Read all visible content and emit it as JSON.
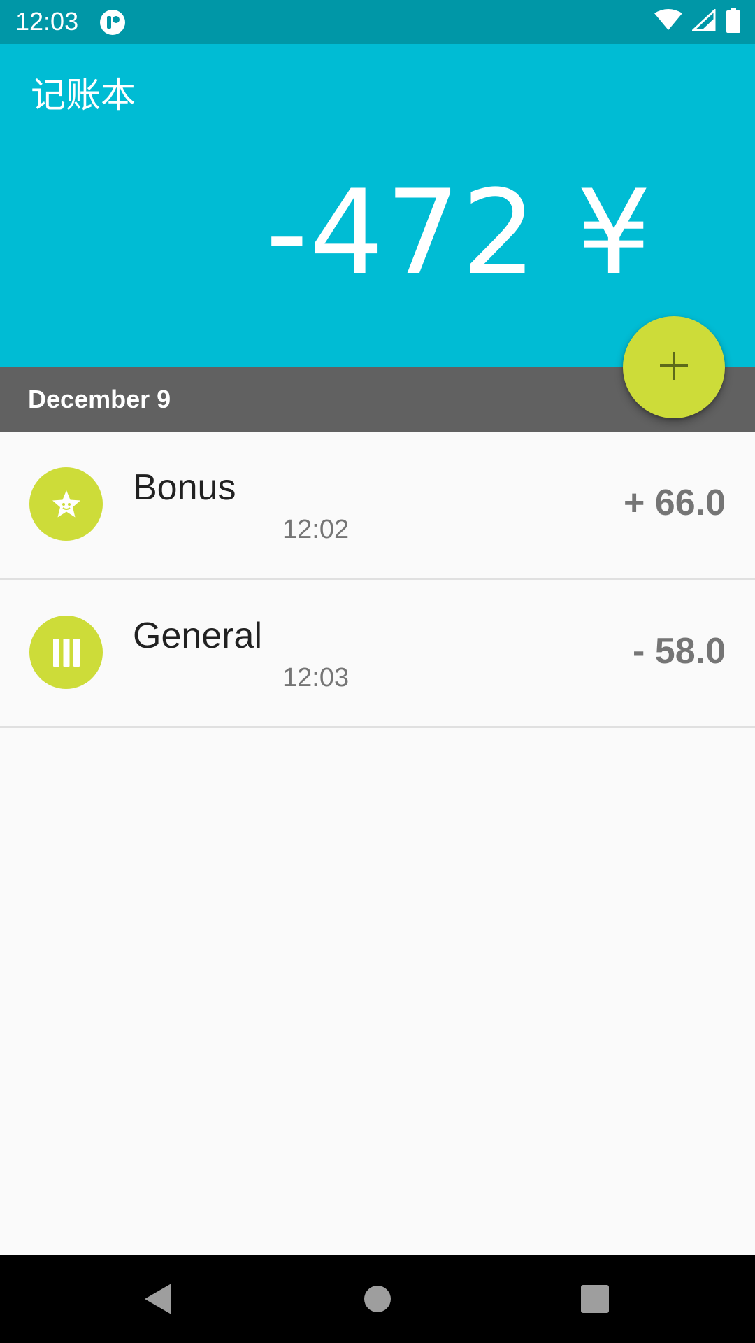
{
  "status_bar": {
    "time": "12:03",
    "icons": [
      "app-notification-icon",
      "wifi-icon",
      "cell-signal-icon",
      "battery-icon"
    ],
    "background_color": "#0097a7"
  },
  "app_bar": {
    "title": "记账本",
    "balance": "-472 ¥",
    "background_color": "#00bcd4"
  },
  "fab": {
    "icon": "plus-icon",
    "label": "+",
    "color": "#cddc39"
  },
  "date_header": {
    "label": "December 9",
    "background_color": "#616161"
  },
  "transactions": [
    {
      "category": "Bonus",
      "time": "12:02",
      "amount": "+ 66.0",
      "icon": "star-icon"
    },
    {
      "category": "General",
      "time": "12:03",
      "amount": "- 58.0",
      "icon": "general-bars-icon"
    }
  ],
  "nav_bar": {
    "buttons": [
      "back-icon",
      "home-icon",
      "recents-icon"
    ]
  },
  "colors": {
    "accent": "#cddc39",
    "primary": "#00bcd4",
    "primary_dark": "#0097a7"
  }
}
